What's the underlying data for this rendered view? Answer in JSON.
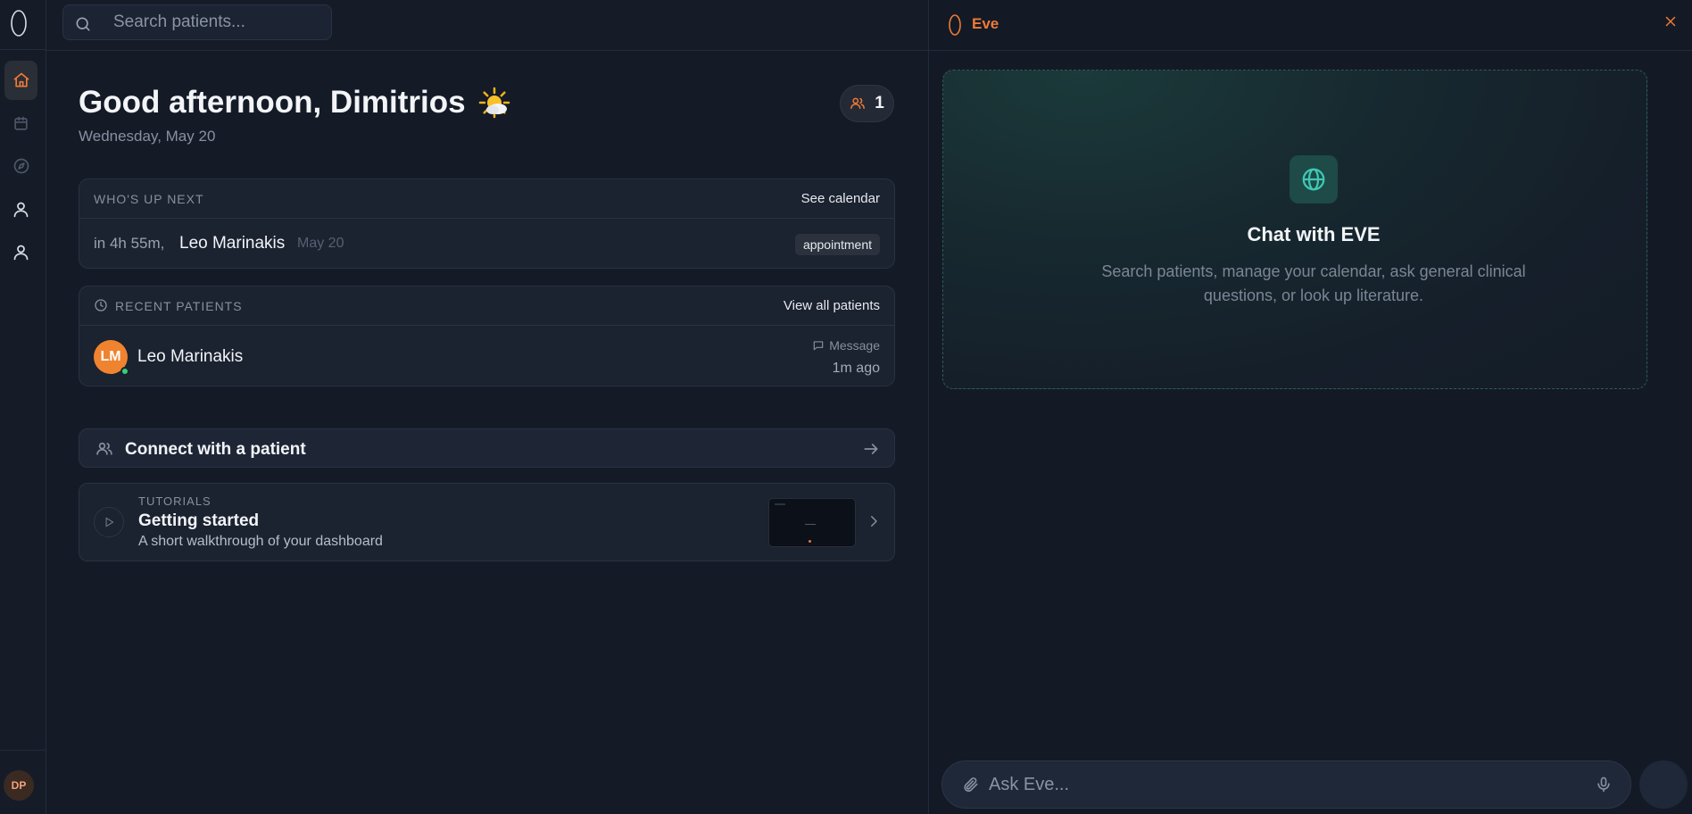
{
  "app": {
    "accent": "#f07a36",
    "teal": "#3ec9b4"
  },
  "search": {
    "placeholder": "Search patients..."
  },
  "sidebar": {
    "items": [
      {
        "icon": "home-icon",
        "active": true
      },
      {
        "icon": "calendar-icon",
        "active": false
      },
      {
        "icon": "compass-icon",
        "active": false
      },
      {
        "icon": "user-icon",
        "active": false
      },
      {
        "icon": "user-icon",
        "active": false
      }
    ],
    "user_initials": "DP"
  },
  "main": {
    "greeting": "Good afternoon, Dimitrios",
    "date": "Wednesday, May 20",
    "active_count": "1",
    "up_next": {
      "label": "WHO'S UP NEXT",
      "link": "See calendar",
      "time": "in 4h 55m,",
      "name": "Leo Marinakis",
      "date": "May 20",
      "badge": "appointment"
    },
    "recent": {
      "label": "RECENT PATIENTS",
      "link": "View all patients",
      "patient": {
        "initials": "LM",
        "name": "Leo Marinakis",
        "message_label": "Message",
        "ago": "1m ago"
      }
    },
    "connect_label": "Connect with a patient",
    "tutorial": {
      "kicker": "TUTORIALS",
      "title": "Getting started",
      "subtitle": "A short walkthrough of your dashboard"
    }
  },
  "eve": {
    "title": "Eve",
    "card_title": "Chat with EVE",
    "card_subtitle": "Search patients, manage your calendar, ask general clinical questions, or look up literature.",
    "input_placeholder": "Ask Eve..."
  }
}
